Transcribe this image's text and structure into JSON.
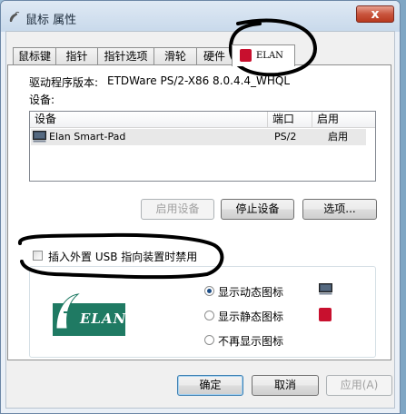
{
  "window": {
    "title": "鼠标 属性",
    "close_label": "x"
  },
  "tabs": [
    {
      "label": "鼠标键"
    },
    {
      "label": "指针"
    },
    {
      "label": "指针选项"
    },
    {
      "label": "滑轮"
    },
    {
      "label": "硬件"
    },
    {
      "label": "ELAN"
    }
  ],
  "driver": {
    "label": "驱动程序版本:",
    "value": "ETDWare PS/2-X86 8.0.4.4_WHQL"
  },
  "devices": {
    "label": "设备:",
    "columns": [
      "设备",
      "端口",
      "启用"
    ],
    "rows": [
      {
        "name": "Elan Smart-Pad",
        "port": "PS/2",
        "enabled": "启用"
      }
    ]
  },
  "buttons": {
    "enable_device": "启用设备",
    "disable_device": "停止设备",
    "options": "选项..."
  },
  "usb_checkbox": {
    "label": "插入外置 USB 指向装置时禁用"
  },
  "logo": {
    "text": "ELAN"
  },
  "icon_options": [
    {
      "label": "显示动态图标",
      "checked": true
    },
    {
      "label": "显示静态图标",
      "checked": false
    },
    {
      "label": "不再显示图标",
      "checked": false
    }
  ],
  "footer": {
    "ok": "确定",
    "cancel": "取消",
    "apply": "应用(A)"
  },
  "colors": {
    "elan_red": "#c8102e",
    "elan_green": "#1f7a63",
    "selection": "#e8e8e8"
  }
}
